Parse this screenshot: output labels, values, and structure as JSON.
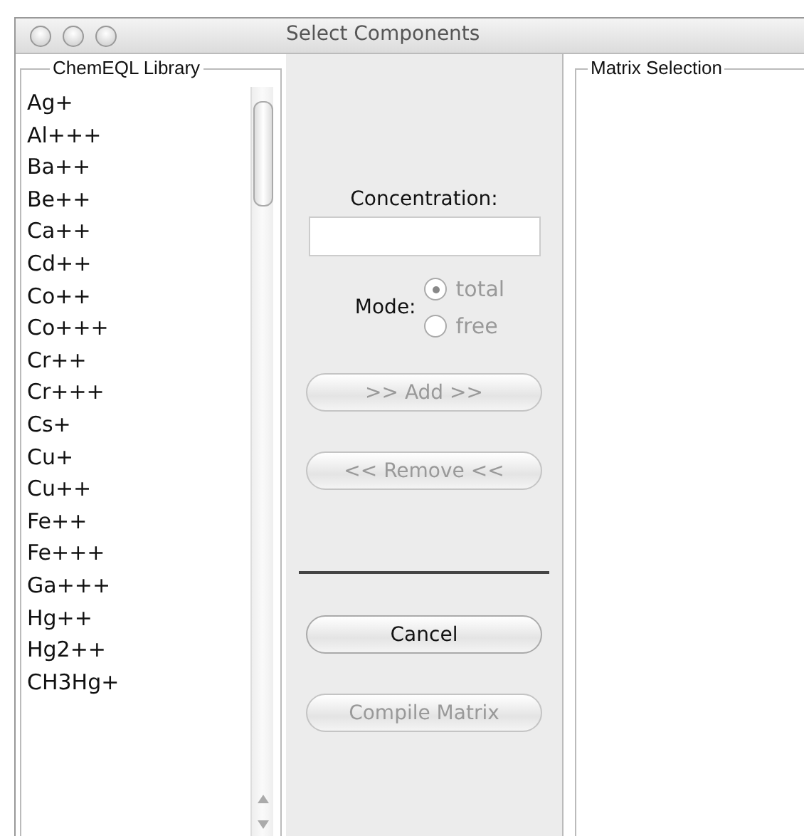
{
  "window": {
    "title": "Select Components"
  },
  "library": {
    "title": "ChemEQL Library",
    "items": [
      {
        "label": "Ag+"
      },
      {
        "label": "Al+++"
      },
      {
        "label": "Ba++"
      },
      {
        "label": "Be++"
      },
      {
        "label": "Ca++"
      },
      {
        "label": "Cd++"
      },
      {
        "label": "Co++"
      },
      {
        "label": "Co+++"
      },
      {
        "label": "Cr++"
      },
      {
        "label": "Cr+++"
      },
      {
        "label": "Cs+"
      },
      {
        "label": "Cu+"
      },
      {
        "label": "Cu++"
      },
      {
        "label": "Fe++"
      },
      {
        "label": "Fe+++"
      },
      {
        "label": "Ga+++"
      },
      {
        "label": "Hg++"
      },
      {
        "label": "Hg2++"
      },
      {
        "label": "CH3Hg+"
      }
    ]
  },
  "concentration": {
    "label": "Concentration:"
  },
  "mode": {
    "label": "Mode:",
    "disabled": true,
    "options": [
      {
        "label": "total",
        "selected": true
      },
      {
        "label": "free",
        "selected": false
      }
    ]
  },
  "buttons_top": [
    {
      "label": ">> Add >>",
      "disabled": true
    },
    {
      "label": "<< Remove <<",
      "disabled": true
    }
  ],
  "buttons_bottom": [
    {
      "label": "Cancel",
      "disabled": false
    },
    {
      "label": "Compile Matrix",
      "disabled": true
    }
  ],
  "matrix": {
    "title": "Matrix Selection"
  }
}
